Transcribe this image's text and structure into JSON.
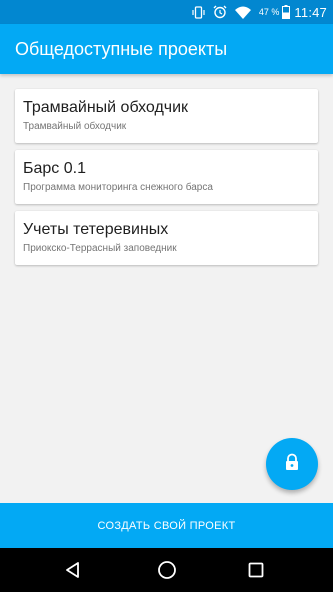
{
  "status_bar": {
    "battery_percent": "47 %",
    "time": "11:47",
    "icons": [
      "vibrate-icon",
      "alarm-icon",
      "wifi-icon",
      "battery-icon"
    ]
  },
  "app_bar": {
    "title": "Общедоступные проекты"
  },
  "projects": [
    {
      "title": "Трамвайный обходчик",
      "subtitle": "Трамвайный обходчик"
    },
    {
      "title": "Барс 0.1",
      "subtitle": "Программа мониторинга снежного барса"
    },
    {
      "title": "Учеты тетеревиных",
      "subtitle": "Приокско-Террасный заповедник"
    }
  ],
  "fab": {
    "icon": "lock-icon"
  },
  "bottom_action": {
    "label": "СОЗДАТЬ СВОЙ ПРОЕКТ"
  },
  "nav_bar": {
    "icons": [
      "back-icon",
      "home-icon",
      "recents-icon"
    ]
  },
  "colors": {
    "primary": "#03a9f4",
    "primary_dark": "#0287d0",
    "background": "#f2f2f2",
    "card": "#ffffff"
  }
}
